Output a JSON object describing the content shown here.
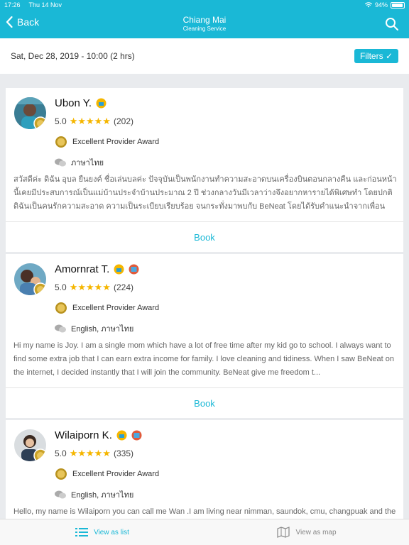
{
  "status": {
    "time": "17:26",
    "date": "Thu 14 Nov",
    "battery": "94%",
    "battery_level": 0.94
  },
  "nav": {
    "back_label": "Back",
    "title": "Chiang Mai",
    "subtitle": "Cleaning Service"
  },
  "booking": {
    "date_text": "Sat, Dec 28, 2019 - 10:00 (2 hrs)",
    "filters_label": "Filters ✓"
  },
  "providers": [
    {
      "name": "Ubon Y.",
      "rating": "5.0",
      "stars": "★★★★★",
      "reviews": "(202)",
      "award": "Excellent Provider Award",
      "languages": "ภาษาไทย",
      "description": "สวัสดีค่ะ ดิฉัน อุบล ยืนยงค์ ชื่อเล่นบลค่ะ ปัจจุบันเป็นพนักงานทำความสะอาดบนเครื่องบินตอนกลางคืน และก่อนหน้านี้เคยมีประสบการณ์เป็นแม่บ้านประจำบ้านประมาณ 2 ปี ช่วงกลางวันมีเวลาว่างจึงอยากหารายได้พิเศษทำ โดยปกติดิฉันเป็นคนรักความสะอาด ความเป็นระเบียบเรียบร้อย จนกระทั่งมาพบกับ BeNeat โดยได้รับคำแนะนำจากเพื่อนที่มาทำ...",
      "book_label": "Book"
    },
    {
      "name": "Amornrat T.",
      "rating": "5.0",
      "stars": "★★★★★",
      "reviews": "(224)",
      "award": "Excellent Provider Award",
      "languages": "English, ภาษาไทย",
      "description": "Hi my name is Joy. I am a single mom which have a lot of free time after my kid go to school. I always want to find some extra job that I can earn extra income for family. I love cleaning and tidiness. When I saw BeNeat on the internet, I decided instantly that I will join the community. BeNeat give me freedom t...",
      "book_label": "Book"
    },
    {
      "name": "Wilaiporn K.",
      "rating": "5.0",
      "stars": "★★★★★",
      "reviews": "(335)",
      "award": "Excellent Provider Award",
      "languages": "English, ภาษาไทย",
      "description": "Hello, my name is Wilaiporn you can call me Wan .I am living near nimman, saundok, cmu, changpuak and the city. I am graduated bachelor degree . My service is both room cleaning, kitchen living",
      "book_label": "Book"
    }
  ],
  "tabs": {
    "list_label": "View as list",
    "map_label": "View as map"
  },
  "colors": {
    "accent": "#1ab8d6",
    "star": "#f5b600"
  }
}
